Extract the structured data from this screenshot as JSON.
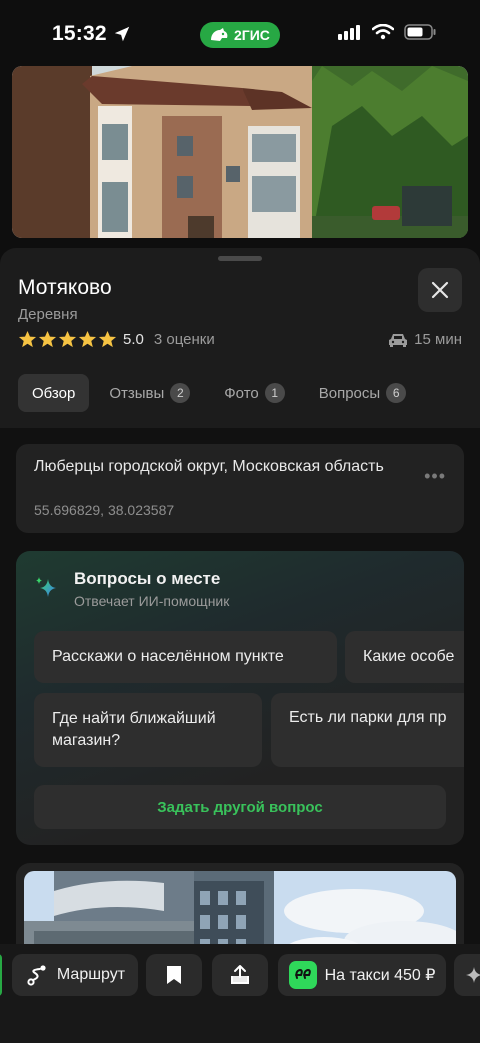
{
  "status_bar": {
    "time": "15:32",
    "brand": "2ГИС"
  },
  "place": {
    "name": "Мотяково",
    "type": "Деревня",
    "rating_value": "5.0",
    "rating_count": "3 оценки",
    "stars": 5,
    "travel_time": "15 мин"
  },
  "tabs": [
    {
      "label": "Обзор",
      "badge": ""
    },
    {
      "label": "Отзывы",
      "badge": "2"
    },
    {
      "label": "Фото",
      "badge": "1"
    },
    {
      "label": "Вопросы",
      "badge": "6"
    }
  ],
  "address": {
    "text": "Люберцы городской округ, Московская область",
    "coords": "55.696829, 38.023587"
  },
  "ai": {
    "title": "Вопросы о месте",
    "subtitle": "Отвечает ИИ-помощник",
    "chips": [
      "Расскажи о населённом пункте",
      "Какие особе",
      "Где найти ближайший магазин?",
      "Есть ли парки для пр"
    ],
    "ask_label": "Задать другой вопрос"
  },
  "actions": {
    "route": "Маршрут",
    "taxi": "На такси 450 ₽"
  },
  "colors": {
    "accent_green": "#27a844",
    "ask_green": "#39c25b",
    "star": "#f6c343"
  }
}
